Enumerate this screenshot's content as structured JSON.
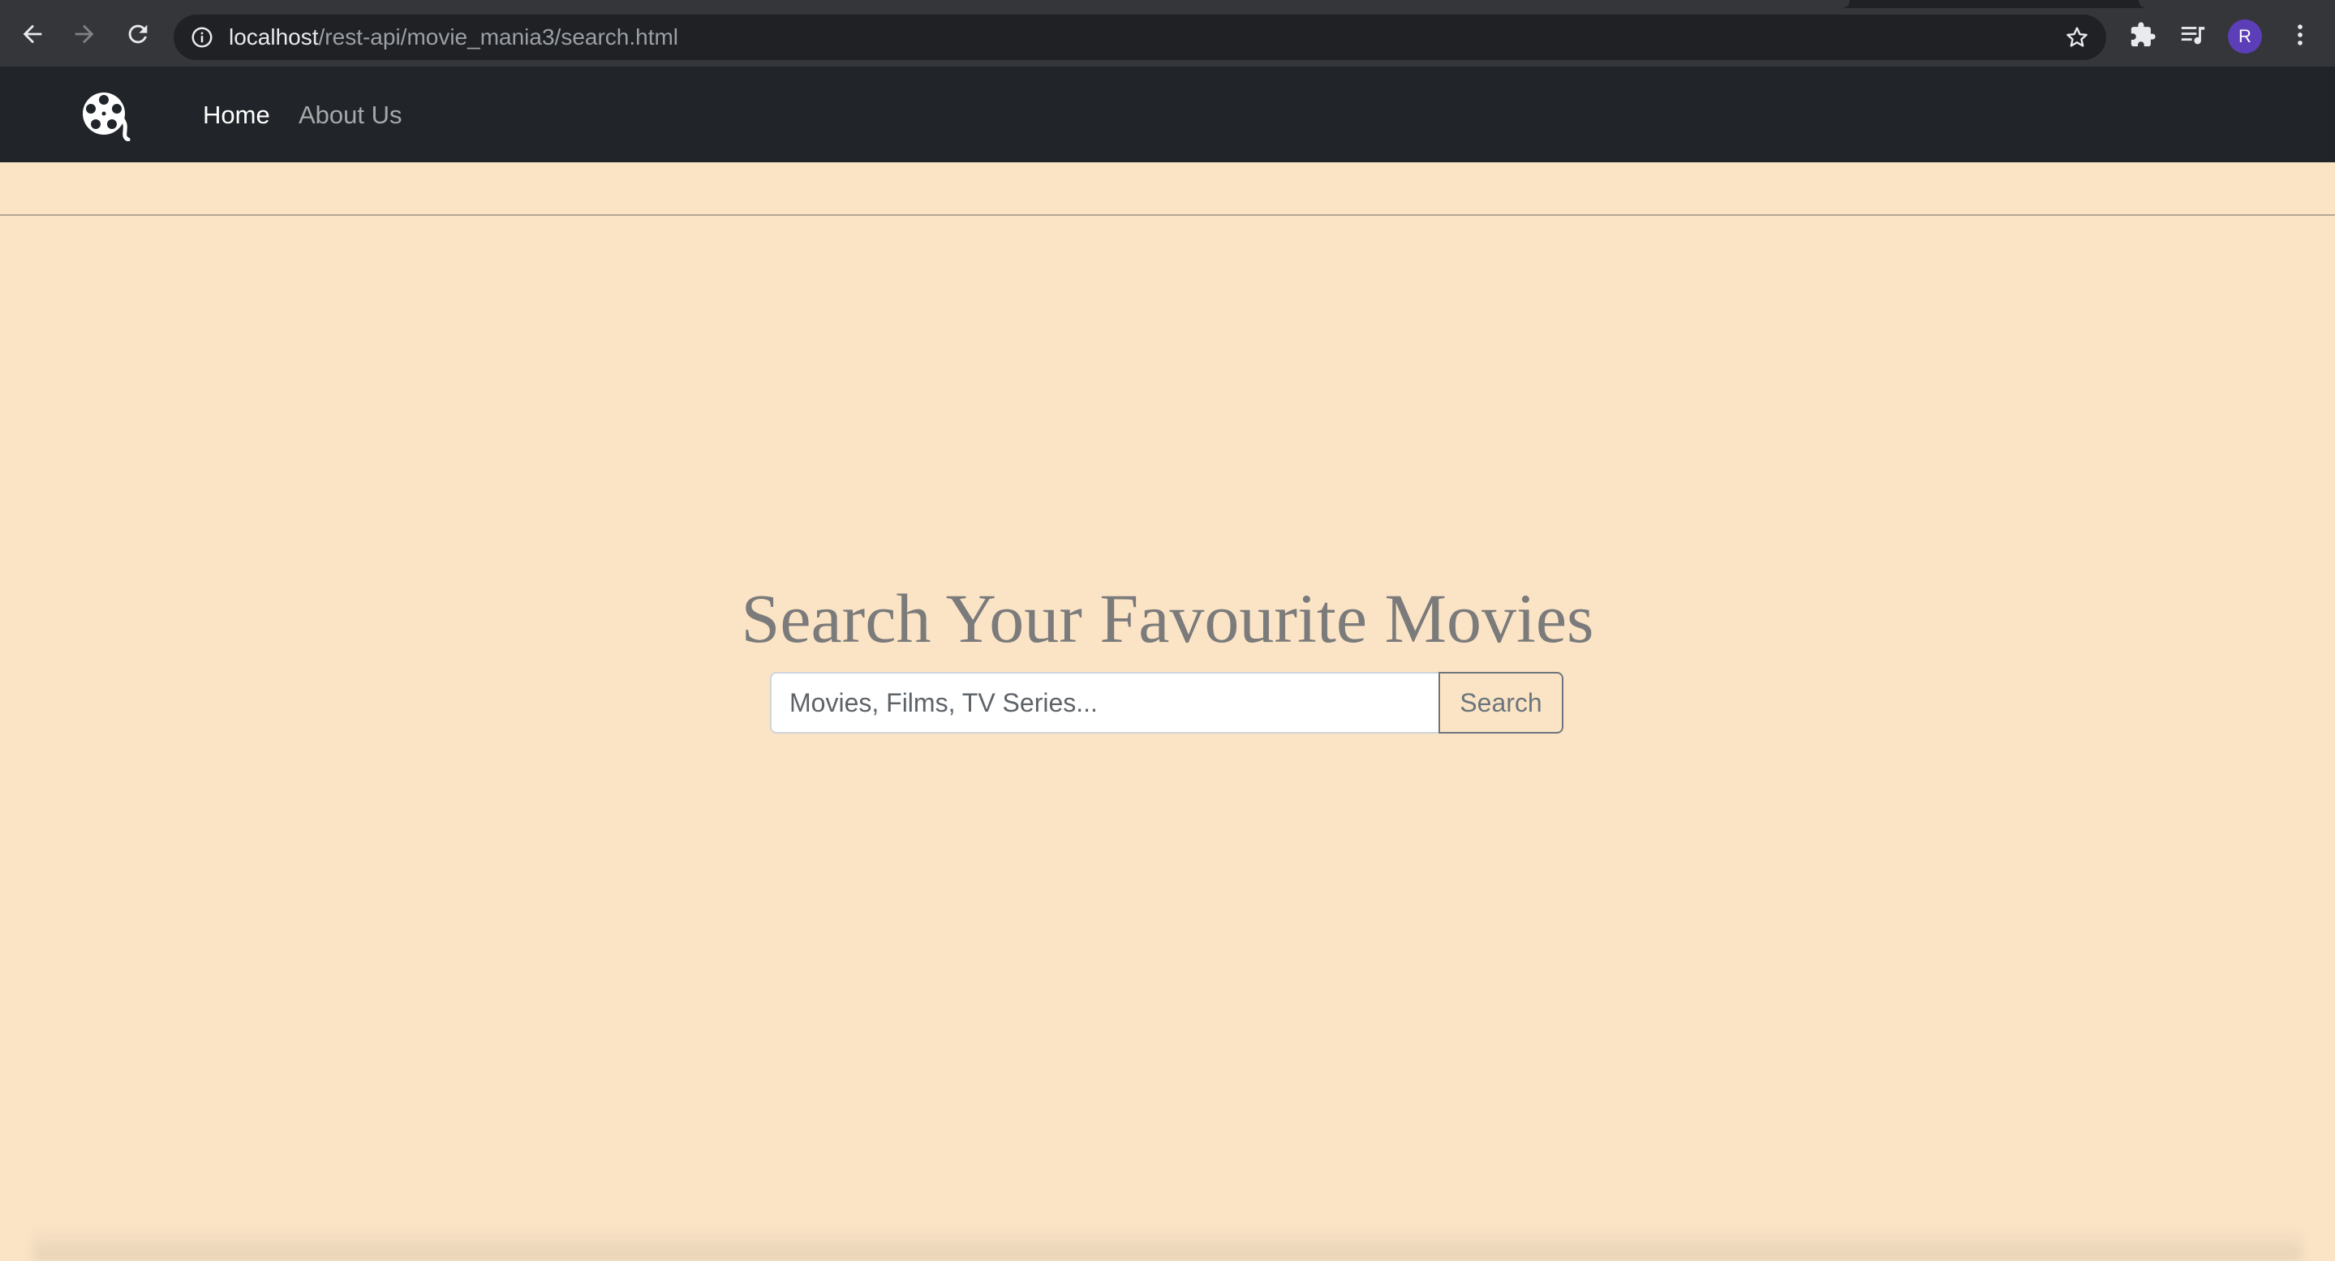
{
  "browser": {
    "url_host": "localhost",
    "url_path": "/rest-api/movie_mania3/search.html",
    "profile_initial": "R"
  },
  "navbar": {
    "brand_icon": "film-reel-icon",
    "links": [
      {
        "label": "Home",
        "active": true
      },
      {
        "label": "About Us",
        "active": false
      }
    ]
  },
  "hero": {
    "title": "Search Your Favourite Movies"
  },
  "search": {
    "placeholder": "Movies, Films, TV Series...",
    "value": "",
    "button_label": "Search"
  },
  "colors": {
    "page_background": "#fbe4c6",
    "navbar_background": "#212529",
    "title_color": "#7b7b7b",
    "button_outline": "#6c757d"
  }
}
